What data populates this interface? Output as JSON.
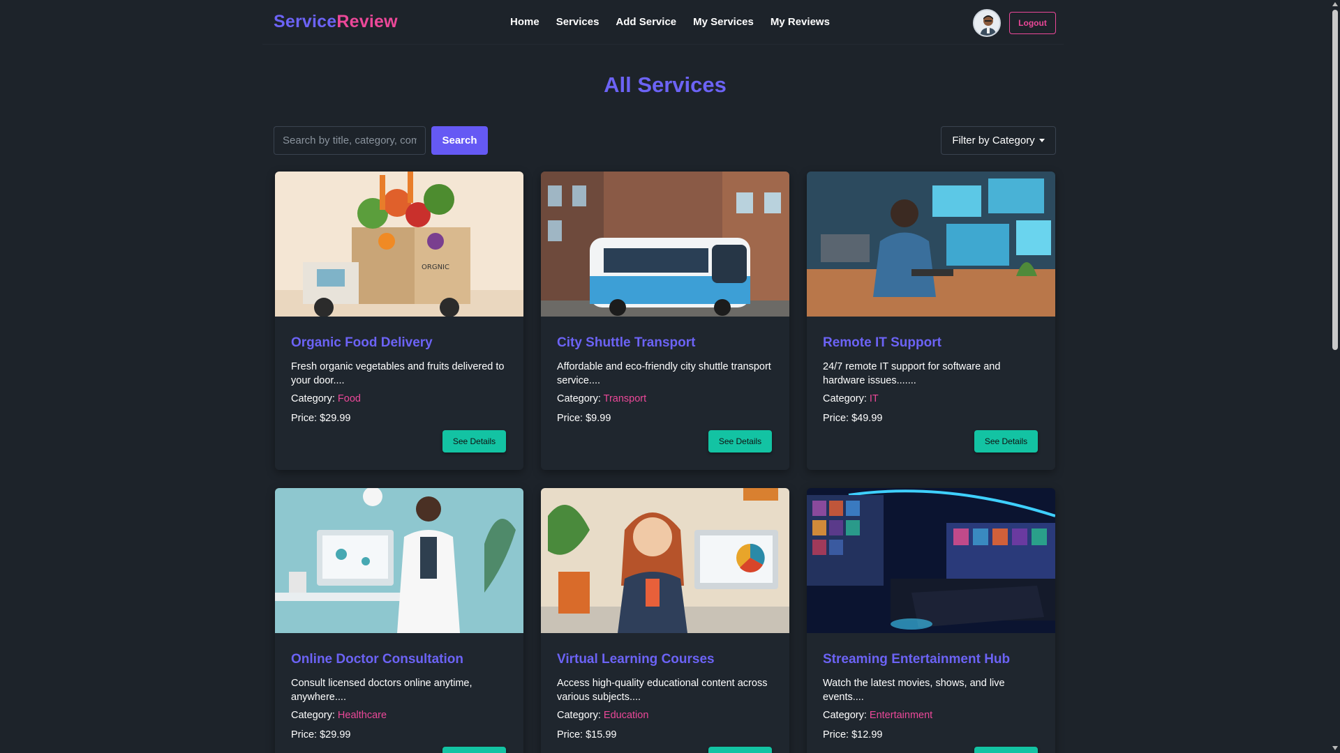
{
  "nav": {
    "logo_part1": "Service",
    "logo_part2": "Review",
    "links": [
      "Home",
      "Services",
      "Add Service",
      "My Services",
      "My Reviews"
    ],
    "logout": "Logout"
  },
  "page": {
    "title": "All Services"
  },
  "search": {
    "placeholder": "Search by title, category, company",
    "button": "Search"
  },
  "filter": {
    "label": "Filter by Category"
  },
  "labels": {
    "category": "Category: ",
    "details_button": "See Details"
  },
  "services": [
    {
      "title": "Organic Food Delivery",
      "description": "Fresh organic vegetables and fruits delivered to your door....",
      "category": "Food",
      "price": "Price: $29.99"
    },
    {
      "title": "City Shuttle Transport",
      "description": "Affordable and eco-friendly city shuttle transport service....",
      "category": "Transport",
      "price": "Price: $9.99"
    },
    {
      "title": "Remote IT Support",
      "description": "24/7 remote IT support for software and hardware issues.......",
      "category": "IT",
      "price": "Price: $49.99"
    },
    {
      "title": "Online Doctor Consultation",
      "description": "Consult licensed doctors online anytime, anywhere....",
      "category": "Healthcare",
      "price": "Price: $29.99"
    },
    {
      "title": "Virtual Learning Courses",
      "description": "Access high-quality educational content across various subjects....",
      "category": "Education",
      "price": "Price: $15.99"
    },
    {
      "title": "Streaming Entertainment Hub",
      "description": "Watch the latest movies, shows, and live events....",
      "category": "Entertainment",
      "price": "Price: $12.99"
    }
  ],
  "colors": {
    "background": "#1d232a",
    "brand": "#6c63f5",
    "accent": "#ec4899",
    "details_button": "#13c3a3"
  }
}
